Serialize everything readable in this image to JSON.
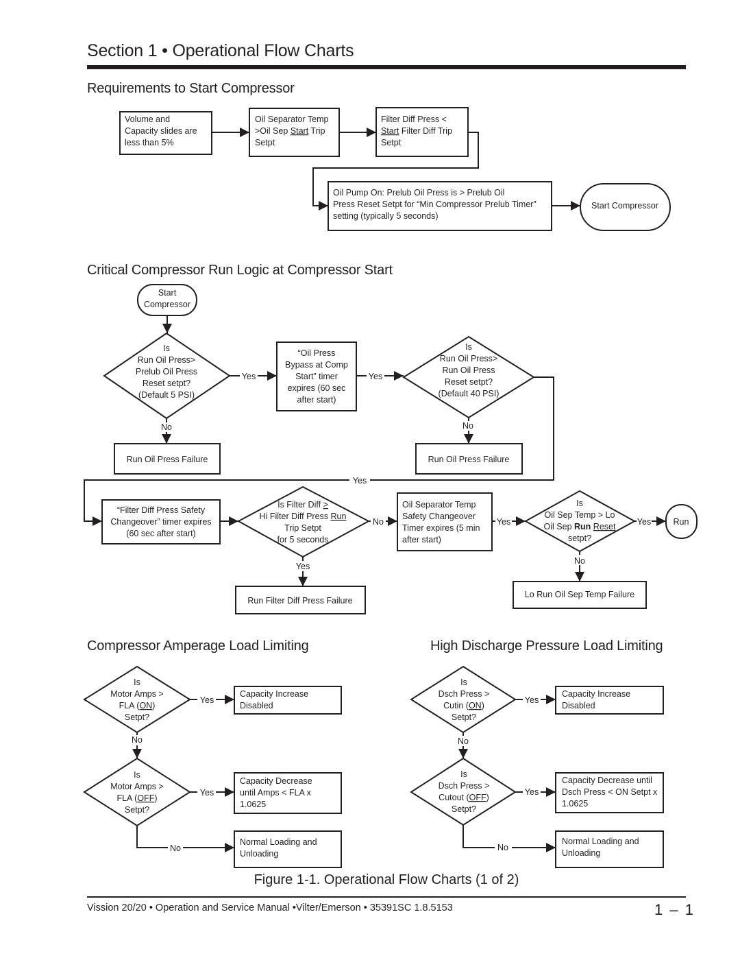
{
  "page": {
    "section_title": "Section 1 • Operational Flow Charts",
    "figure_caption": "Figure 1-1. Operational Flow Charts (1 of 2)",
    "footer_text": "Vission 20/20 • Operation and Service Manual •Vilter/Emerson • 35391SC 1.8.5153",
    "page_number": "1 – 1"
  },
  "sections": {
    "requirements": {
      "title": "Requirements to Start Compressor",
      "nodes": {
        "slides": [
          "Volume and",
          "Capacity slides are",
          "less than 5%"
        ],
        "oil_sep_temp": [
          ">Oil Sep ",
          "Start",
          " Trip"
        ],
        "oil_sep_temp_l1": "Oil Separator Temp",
        "oil_sep_temp_l3": "Setpt",
        "filter_diff_l1": "Filter Diff Press <",
        "filter_diff_l2_u": "Start",
        "filter_diff_l2_rest": " Filter Diff Trip",
        "filter_diff_l3": "Setpt",
        "oil_pump": [
          "Oil Pump On: Prelub Oil Press is > Prelub Oil",
          "Press Reset Setpt for “Min Compressor Prelub Timer”",
          "setting (typically 5 seconds)"
        ],
        "start_compressor": "Start Compressor"
      }
    },
    "run_logic": {
      "title": "Critical Compressor Run Logic at Compressor Start",
      "nodes": {
        "start": [
          "Start",
          "Compressor"
        ],
        "d1": [
          "Is",
          "Run Oil Press>",
          "Prelub Oil Press",
          "Reset setpt?",
          "(Default 5 PSI)"
        ],
        "bypass": [
          "“Oil Press",
          "Bypass at Comp",
          "Start” timer",
          "expires (60 sec",
          "after start)"
        ],
        "d2": [
          "Is",
          "Run Oil Press>",
          "Run Oil Press",
          "Reset setpt?",
          "(Default 40 PSI)"
        ],
        "fail1": "Run Oil Press Failure",
        "fail2": "Run Oil Press Failure",
        "filter_timer": [
          "“Filter Diff Press Safety",
          "Changeover” timer expires",
          "(60 sec after start)"
        ],
        "d3_l1": "Is Filter Diff ",
        "d3_l1_u": ">",
        "d3_l2": "Hi Filter Diff Press ",
        "d3_l2_u": "Run",
        "d3_l3": "Trip Setpt",
        "d3_l4": "for 5 seconds",
        "filter_fail": "Run Filter Diff Press Failure",
        "sep_timer": [
          "Oil Separator Temp",
          "Safety Changeover",
          "Timer expires (5 min",
          "after start)"
        ],
        "d4_l1": "Is",
        "d4_l2": "Oil Sep Temp > Lo",
        "d4_l3a": "Oil Sep ",
        "d4_l3b": "Run",
        "d4_l3c": "Reset",
        "d4_l4": "setpt?",
        "run": "Run",
        "sep_fail": "Lo Run Oil Sep Temp Failure"
      }
    },
    "amperage": {
      "title": "Compressor Amperage Load Limiting",
      "d1": [
        "Is",
        "Motor Amps >",
        "FLA (",
        "ON",
        ")",
        "Setpt?"
      ],
      "d2": [
        "Is",
        "Motor Amps >",
        "FLA (",
        "OFF",
        ")",
        "Setpt?"
      ],
      "box1": [
        "Capacity Increase",
        "Disabled"
      ],
      "box2": [
        "Capacity Decrease",
        "until Amps < FLA x",
        "1.0625"
      ],
      "box3": [
        "Normal Loading and",
        "Unloading"
      ]
    },
    "discharge": {
      "title": "High Discharge Pressure  Load Limiting",
      "d1": [
        "Is",
        "Dsch Press >",
        "Cutin (",
        "ON",
        ")",
        "Setpt?"
      ],
      "d2": [
        "Is",
        "Dsch Press >",
        "Cutout (",
        "OFF",
        ")",
        "Setpt?"
      ],
      "box1": [
        "Capacity Increase",
        "Disabled"
      ],
      "box2": [
        "Capacity Decrease until",
        "Dsch Press < ON Setpt x",
        "1.0625"
      ],
      "box3": [
        "Normal Loading and",
        "Unloading"
      ]
    }
  },
  "labels": {
    "yes": "Yes",
    "no": "No"
  }
}
